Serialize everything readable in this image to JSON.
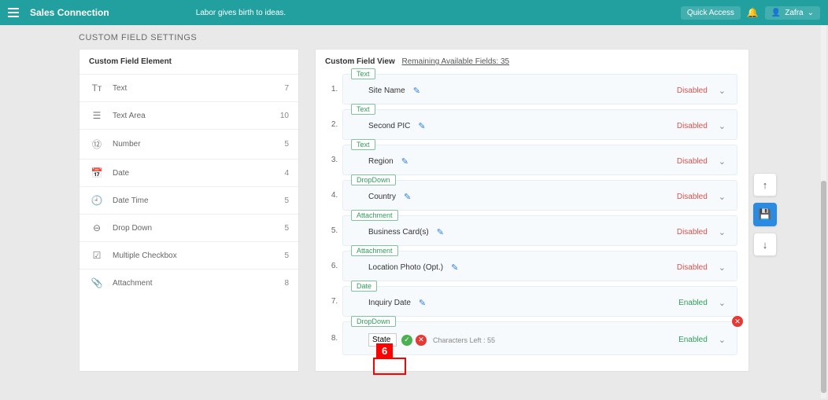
{
  "topbar": {
    "brand": "Sales Connection",
    "tagline": "Labor gives birth to ideas.",
    "quick_access": "Quick Access",
    "user": "Zafra"
  },
  "page_title": "CUSTOM FIELD SETTINGS",
  "left_panel_title": "Custom Field Element",
  "elements": [
    {
      "label": "Text",
      "count": "7",
      "glyph": "Tт"
    },
    {
      "label": "Text Area",
      "count": "10",
      "glyph": "☰"
    },
    {
      "label": "Number",
      "count": "5",
      "glyph": "⑫"
    },
    {
      "label": "Date",
      "count": "4",
      "glyph": "📅"
    },
    {
      "label": "Date Time",
      "count": "5",
      "glyph": "🕘"
    },
    {
      "label": "Drop Down",
      "count": "5",
      "glyph": "⊖"
    },
    {
      "label": "Multiple Checkbox",
      "count": "5",
      "glyph": "☑"
    },
    {
      "label": "Attachment",
      "count": "8",
      "glyph": "📎"
    }
  ],
  "right_panel": {
    "title": "Custom Field View",
    "remaining_label": "Remaining Available Fields: 35"
  },
  "fields": [
    {
      "num": "1.",
      "type": "Text",
      "name": "Site Name",
      "status": "Disabled"
    },
    {
      "num": "2.",
      "type": "Text",
      "name": "Second PIC",
      "status": "Disabled"
    },
    {
      "num": "3.",
      "type": "Text",
      "name": "Region",
      "status": "Disabled"
    },
    {
      "num": "4.",
      "type": "DropDown",
      "name": "Country",
      "status": "Disabled"
    },
    {
      "num": "5.",
      "type": "Attachment",
      "name": "Business Card(s)",
      "status": "Disabled"
    },
    {
      "num": "6.",
      "type": "Attachment",
      "name": "Location Photo (Opt.)",
      "status": "Disabled"
    },
    {
      "num": "7.",
      "type": "Date",
      "name": "Inquiry Date",
      "status": "Enabled"
    }
  ],
  "editing_field": {
    "num": "8.",
    "type": "DropDown",
    "value": "State",
    "chars_left": "Characters Left : 55",
    "status": "Enabled"
  },
  "callout": "6"
}
